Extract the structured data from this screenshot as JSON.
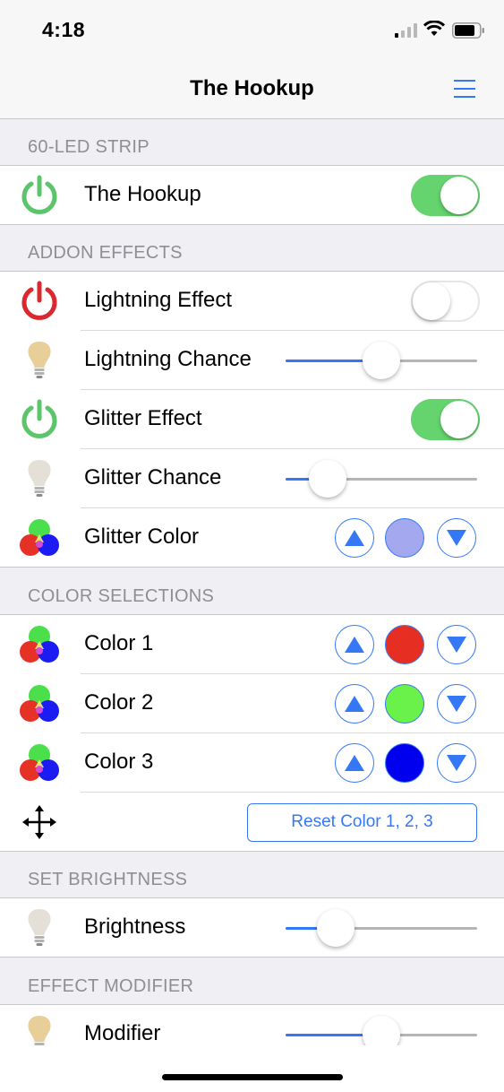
{
  "status_bar": {
    "time": "4:18"
  },
  "nav": {
    "title": "The Hookup"
  },
  "sections": {
    "strip": "60-LED STRIP",
    "addon": "ADDON EFFECTS",
    "colors": "COLOR SELECTIONS",
    "brightness": "SET BRIGHTNESS",
    "modifier": "EFFECT MODIFIER"
  },
  "rows": {
    "hookup": {
      "label": "The Hookup",
      "power_on": true
    },
    "lightning_effect": {
      "label": "Lightning Effect",
      "power_on": false
    },
    "lightning_chance": {
      "label": "Lightning Chance",
      "value": 0.5
    },
    "glitter_effect": {
      "label": "Glitter Effect",
      "power_on": true
    },
    "glitter_chance": {
      "label": "Glitter Chance",
      "value": 0.22
    },
    "glitter_color": {
      "label": "Glitter Color",
      "color": "#a4a8ee"
    },
    "color1": {
      "label": "Color 1",
      "color": "#e62e22"
    },
    "color2": {
      "label": "Color 2",
      "color": "#6bf24a"
    },
    "color3": {
      "label": "Color 3",
      "color": "#0000ee"
    },
    "reset": {
      "label": "Reset Color 1, 2, 3"
    },
    "brightness": {
      "label": "Brightness",
      "value": 0.26
    },
    "modifier": {
      "label": "Modifier",
      "value": 0.5
    }
  },
  "colors": {
    "accent": "#3478f6",
    "power_on": "#5cc46a",
    "power_off": "#d9292e",
    "switch_on": "#65d36e"
  },
  "icons": {
    "power": "power-icon",
    "bulb": "light-bulb-icon",
    "rgb": "rgb-circles-icon",
    "move": "move-arrows-icon",
    "menu": "hamburger-menu-icon",
    "up": "triangle-up-icon",
    "down": "triangle-down-icon"
  }
}
